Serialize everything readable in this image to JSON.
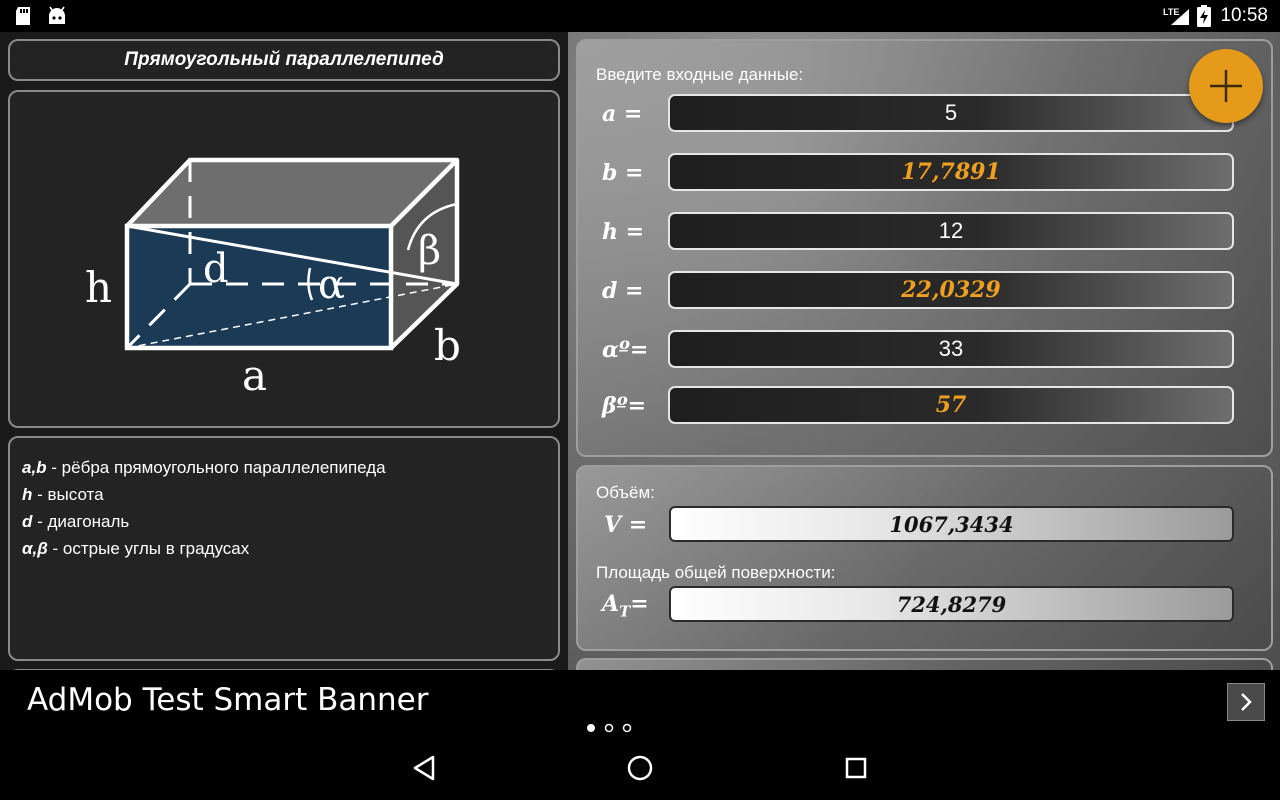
{
  "status_bar": {
    "network": "LTE",
    "time": "10:58"
  },
  "left": {
    "title": "Прямоугольный параллелепипед",
    "figure_labels": {
      "h": "h",
      "d": "d",
      "alpha": "α",
      "beta": "β",
      "a": "a",
      "b": "b"
    },
    "legend": [
      {
        "key": "a,b",
        "desc": " - рёбра прямоугольного параллелепипеда"
      },
      {
        "key": "h",
        "desc": " - высота"
      },
      {
        "key": "d",
        "desc": " - диагональ"
      },
      {
        "key": "α,β",
        "desc": " - острые углы в градусах"
      }
    ]
  },
  "inputs": {
    "header": "Введите входные данные:",
    "fields": [
      {
        "label": "a =",
        "value": "5",
        "computed": false
      },
      {
        "label": "b =",
        "value": "17,7891",
        "computed": true
      },
      {
        "label": "h =",
        "value": "12",
        "computed": false
      },
      {
        "label": "d =",
        "value": "22,0329",
        "computed": true
      },
      {
        "label": "αº=",
        "value": "33",
        "computed": false
      },
      {
        "label": "βº=",
        "value": "57",
        "computed": true
      }
    ]
  },
  "results": {
    "volume_header": "Объём:",
    "volume_label": "V =",
    "volume_value": "1067,3434",
    "area_header": "Площадь общей поверхности:",
    "area_label_main": "A",
    "area_label_sub": "T",
    "area_label_eq": "=",
    "area_value": "724,8279"
  },
  "ad": {
    "text": "AdMob Test Smart Banner"
  },
  "colors": {
    "accent": "#e69a1a",
    "computed_text": "#f0a020",
    "figure_face": "#1b3a55"
  }
}
